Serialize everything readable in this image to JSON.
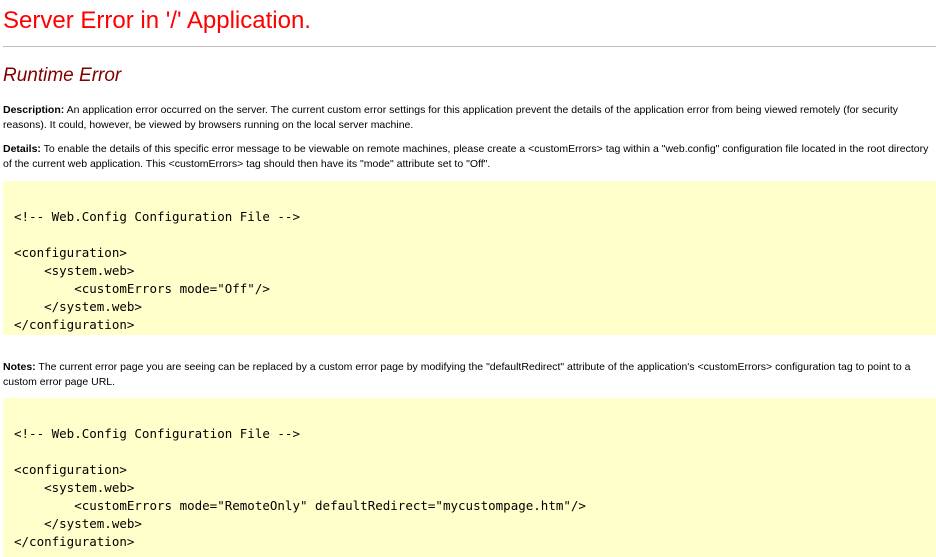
{
  "header": {
    "title": "Server Error in '/' Application.",
    "subtitle": "Runtime Error"
  },
  "description": {
    "label": "Description:",
    "text": " An application error occurred on the server. The current custom error settings for this application prevent the details of the application error from being viewed remotely (for security reasons). It could, however, be viewed by browsers running on the local server machine."
  },
  "details": {
    "label": "Details:",
    "text": " To enable the details of this specific error message to be viewable on remote machines, please create a <customErrors> tag within a \"web.config\" configuration file located in the root directory of the current web application. This <customErrors> tag should then have its \"mode\" attribute set to \"Off\"."
  },
  "code_block_1": {
    "lines": [
      "<!-- Web.Config Configuration File -->",
      "",
      "<configuration>",
      "    <system.web>",
      "        <customErrors mode=\"Off\"/>",
      "    </system.web>",
      "</configuration>"
    ]
  },
  "notes": {
    "label": "Notes:",
    "text": " The current error page you are seeing can be replaced by a custom error page by modifying the \"defaultRedirect\" attribute of the application's <customErrors> configuration tag to point to a custom error page URL."
  },
  "code_block_2": {
    "lines": [
      "<!-- Web.Config Configuration File -->",
      "",
      "<configuration>",
      "    <system.web>",
      "        <customErrors mode=\"RemoteOnly\" defaultRedirect=\"mycustompage.htm\"/>",
      "    </system.web>",
      "</configuration>"
    ]
  },
  "colors": {
    "title": "#ff0000",
    "subtitle": "#800000",
    "code_background": "#ffffcc",
    "rule": "#c0c0c0"
  }
}
